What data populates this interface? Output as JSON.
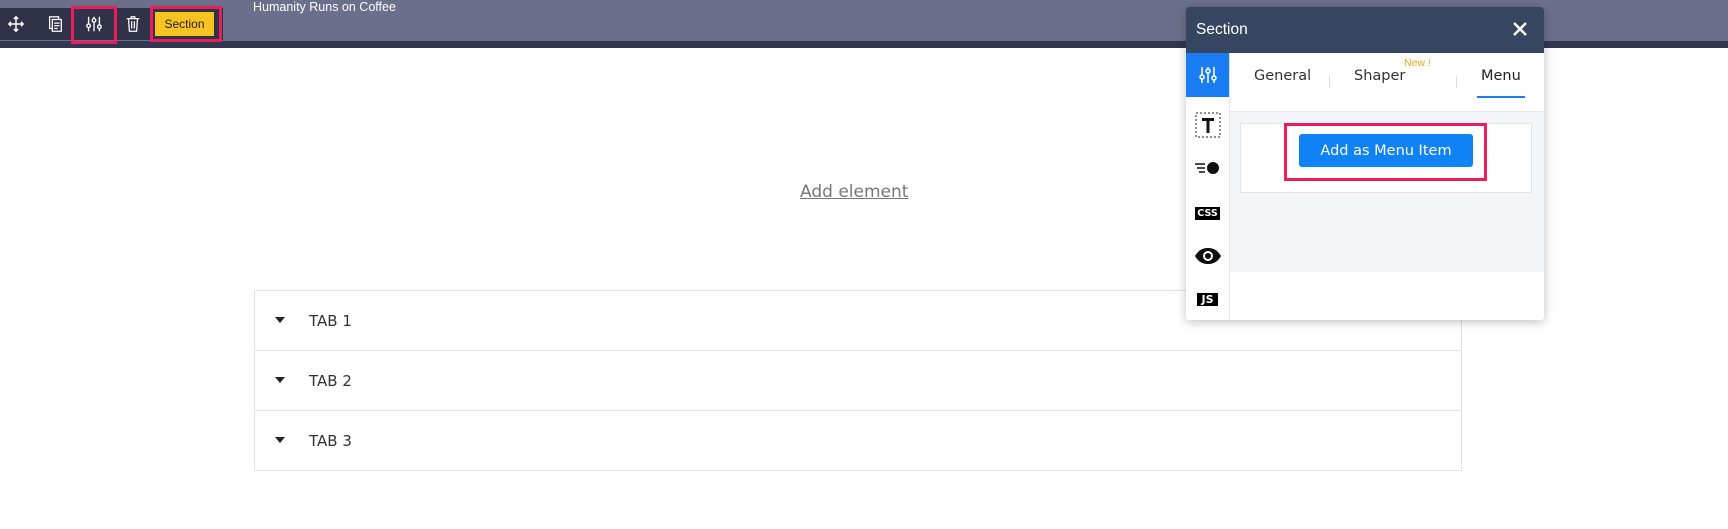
{
  "page": {
    "site_caption": "Humanity Runs on Coffee",
    "add_element_label": "Add element"
  },
  "toolbar": {
    "buttons": [
      {
        "name": "move-icon"
      },
      {
        "name": "duplicate-icon"
      },
      {
        "name": "settings-sliders-icon"
      },
      {
        "name": "delete-icon"
      }
    ],
    "section_label": "Section"
  },
  "accordion": {
    "items": [
      {
        "label": "TAB 1"
      },
      {
        "label": "TAB 2"
      },
      {
        "label": "TAB 3"
      }
    ]
  },
  "panel": {
    "title": "Section",
    "side_icons": [
      {
        "name": "settings-sliders-icon",
        "active": true
      },
      {
        "name": "text-style-icon"
      },
      {
        "name": "animation-icon"
      },
      {
        "name": "css-icon",
        "label": "CSS"
      },
      {
        "name": "visibility-eye-icon"
      },
      {
        "name": "js-icon",
        "label": "JS"
      }
    ],
    "tabs": [
      {
        "label": "General"
      },
      {
        "label": "Shaper",
        "badge": "New !"
      },
      {
        "label": "Menu",
        "active": true
      }
    ],
    "add_menu_button": "Add as Menu Item"
  },
  "colors": {
    "accent_blue": "#0f82f6",
    "highlight_red": "#ea1e5a",
    "section_chip": "#f6c323",
    "panel_header": "#374660"
  }
}
